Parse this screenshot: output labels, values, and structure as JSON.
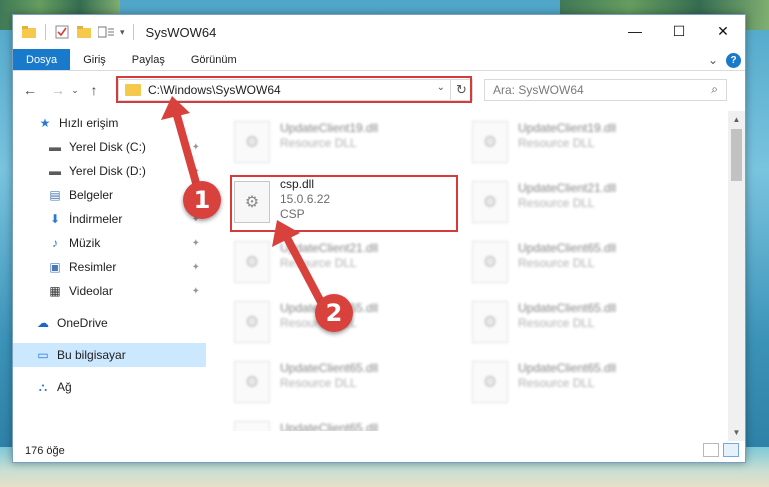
{
  "window": {
    "title": "SysWOW64",
    "controls": {
      "minimize": "—",
      "maximize": "☐",
      "close": "✕"
    }
  },
  "ribbon": {
    "tabs": [
      "Dosya",
      "Giriş",
      "Paylaş",
      "Görünüm"
    ],
    "expand_glyph": "⌄",
    "help_glyph": "?"
  },
  "navigation": {
    "back": "←",
    "forward": "→",
    "recent": "⌄",
    "up": "↑",
    "address": "C:\\Windows\\SysWOW64",
    "address_drop": "⌄",
    "refresh": "↻",
    "search_placeholder": "Ara: SysWOW64",
    "search_icon": "⌕"
  },
  "sidebar": {
    "items": [
      {
        "label": "Hızlı erişim",
        "icon": "star-icon",
        "glyph": "★",
        "color": "#2b79d6"
      },
      {
        "label": "Yerel Disk (C:)",
        "icon": "drive-icon",
        "glyph": "▬",
        "color": "#5b5b5b"
      },
      {
        "label": "Yerel Disk (D:)",
        "icon": "drive-icon",
        "glyph": "▬",
        "color": "#5b5b5b"
      },
      {
        "label": "Belgeler",
        "icon": "documents-icon",
        "glyph": "▤",
        "color": "#4a77b5"
      },
      {
        "label": "İndirmeler",
        "icon": "downloads-icon",
        "glyph": "⬇",
        "color": "#2b79d6"
      },
      {
        "label": "Müzik",
        "icon": "music-icon",
        "glyph": "♪",
        "color": "#2b79d6"
      },
      {
        "label": "Resimler",
        "icon": "pictures-icon",
        "glyph": "▣",
        "color": "#4a77b5"
      },
      {
        "label": "Videolar",
        "icon": "videos-icon",
        "glyph": "▦",
        "color": "#333333"
      },
      {
        "label": "OneDrive",
        "icon": "cloud-icon",
        "glyph": "☁",
        "color": "#1b66c9"
      },
      {
        "label": "Bu bilgisayar",
        "icon": "computer-icon",
        "glyph": "▭",
        "color": "#2b79d6"
      },
      {
        "label": "Ağ",
        "icon": "network-icon",
        "glyph": "⛬",
        "color": "#2b79d6"
      }
    ],
    "pin_glyph": "📌"
  },
  "files": {
    "highlighted": {
      "name": "csp.dll",
      "version": "15.0.6.22",
      "type": "CSP"
    },
    "blurred": [
      {
        "name": "UpdateClient19.dll",
        "type": "Resource DLL"
      },
      {
        "name": "UpdateClient19.dll",
        "type": "Resource DLL"
      },
      {
        "name": "UpdateClient21.dll",
        "type": "Resource DLL"
      },
      {
        "name": "UpdateClient21.dll",
        "type": "Resource DLL"
      },
      {
        "name": "UpdateClient65.dll",
        "type": "Resource DLL"
      },
      {
        "name": "UpdateClient65.dll",
        "type": "Resource DLL"
      },
      {
        "name": "UpdateClient65.dll",
        "type": "Resource DLL"
      },
      {
        "name": "UpdateClient65.dll",
        "type": "Resource DLL"
      },
      {
        "name": "UpdateClient65.dll",
        "type": "Resource DLL"
      },
      {
        "name": "UpdateClient65.dll",
        "type": "Resource DLL"
      }
    ],
    "gear_glyph": "⚙"
  },
  "status": {
    "count": "176 öğe"
  },
  "annotations": {
    "marker1": "1",
    "marker2": "2",
    "highlight_color": "#d63b3b"
  }
}
